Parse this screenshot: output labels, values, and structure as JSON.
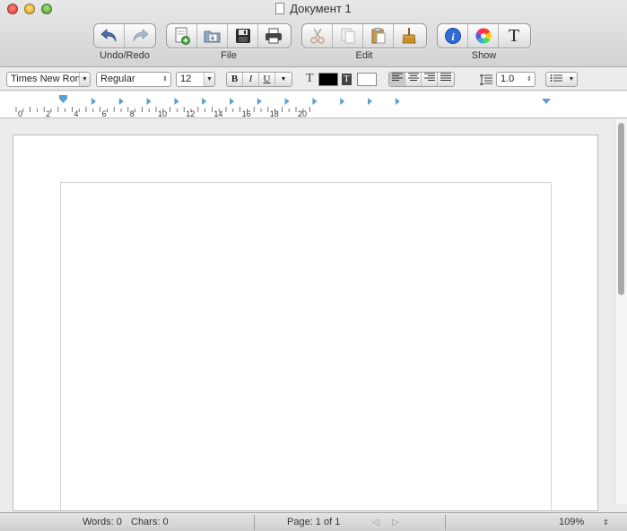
{
  "window": {
    "title": "Документ 1"
  },
  "toolbar": {
    "groups": [
      {
        "label": "Undo/Redo",
        "buttons": [
          "undo-icon",
          "redo-icon"
        ]
      },
      {
        "label": "File",
        "buttons": [
          "new-document-icon",
          "open-document-icon",
          "save-icon",
          "print-icon"
        ]
      },
      {
        "label": "Edit",
        "buttons": [
          "cut-icon",
          "copy-icon",
          "paste-icon",
          "clean-icon"
        ]
      },
      {
        "label": "Show",
        "buttons": [
          "info-icon",
          "color-wheel-icon",
          "font-icon"
        ]
      }
    ],
    "font_glyph": "T"
  },
  "format": {
    "font_family": "Times New Roman",
    "font_style": "Regular",
    "font_size": "12",
    "bold": "B",
    "italic": "I",
    "underline": "U",
    "text_glyph": "T",
    "text_color": "#000000",
    "highlight_color": "#ffffff",
    "line_spacing": "1.0"
  },
  "ruler": {
    "numbers": [
      "0",
      "2",
      "4",
      "6",
      "8",
      "10",
      "12",
      "14",
      "16",
      "18",
      "20"
    ]
  },
  "status": {
    "words": "Words: 0",
    "chars": "Chars: 0",
    "page": "Page: 1 of 1",
    "zoom": "109%"
  }
}
